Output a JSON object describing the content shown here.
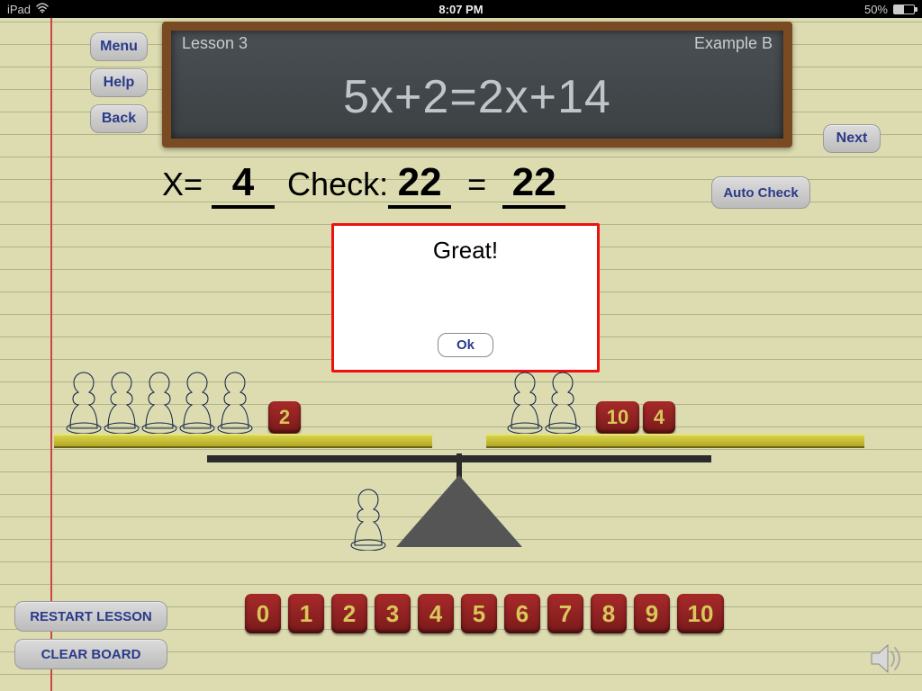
{
  "statusbar": {
    "device": "iPad",
    "time": "8:07 PM",
    "battery_pct": "50%"
  },
  "buttons": {
    "menu": "Menu",
    "help": "Help",
    "back": "Back",
    "next": "Next",
    "auto_check": "Auto Check",
    "restart_lesson": "RESTART LESSON",
    "clear_board": "CLEAR BOARD"
  },
  "chalkboard": {
    "lesson": "Lesson 3",
    "example": "Example B",
    "equation": "5x+2=2x+14"
  },
  "solution": {
    "x_label": "X=",
    "x_value": "4",
    "check_label": "Check:",
    "lhs": "22",
    "eq": "=",
    "rhs": "22"
  },
  "modal": {
    "message": "Great!",
    "ok": "Ok"
  },
  "scale": {
    "left": {
      "pawns": 5,
      "tokens": [
        "2"
      ]
    },
    "right": {
      "pawns": 2,
      "tokens": [
        "10",
        "4"
      ]
    },
    "spare_pawn": true
  },
  "number_strip": [
    "0",
    "1",
    "2",
    "3",
    "4",
    "5",
    "6",
    "7",
    "8",
    "9",
    "10"
  ],
  "icons": {
    "speaker": "speaker-icon",
    "wifi": "wifi-icon"
  }
}
